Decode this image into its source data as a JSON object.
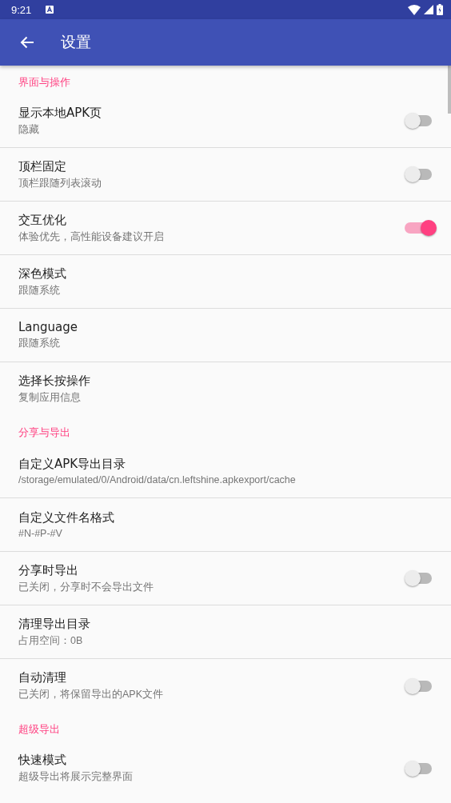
{
  "status_bar": {
    "time": "9:21"
  },
  "app_bar": {
    "title": "设置"
  },
  "sections": [
    {
      "title": "界面与操作",
      "items": [
        {
          "kind": "switch",
          "title": "显示本地APK页",
          "summary": "隐藏",
          "on": false
        },
        {
          "kind": "switch",
          "title": "顶栏固定",
          "summary": "顶栏跟随列表滚动",
          "on": false
        },
        {
          "kind": "switch",
          "title": "交互优化",
          "summary": "体验优先，高性能设备建议开启",
          "on": true
        },
        {
          "kind": "text",
          "title": "深色模式",
          "summary": "跟随系统"
        },
        {
          "kind": "text",
          "title": "Language",
          "summary": "跟随系统"
        },
        {
          "kind": "text",
          "title": "选择长按操作",
          "summary": "复制应用信息"
        }
      ]
    },
    {
      "title": "分享与导出",
      "items": [
        {
          "kind": "text",
          "title": "自定义APK导出目录",
          "summary": "/storage/emulated/0/Android/data/cn.leftshine.apkexport/cache"
        },
        {
          "kind": "text",
          "title": "自定义文件名格式",
          "summary": "#N-#P-#V"
        },
        {
          "kind": "switch",
          "title": "分享时导出",
          "summary": "已关闭，分享时不会导出文件",
          "on": false
        },
        {
          "kind": "text",
          "title": "清理导出目录",
          "summary": "占用空间：0B"
        },
        {
          "kind": "switch",
          "title": "自动清理",
          "summary": "已关闭，将保留导出的APK文件",
          "on": false
        }
      ]
    },
    {
      "title": "超级导出",
      "items": [
        {
          "kind": "switch",
          "title": "快速模式",
          "summary": "超级导出将展示完整界面",
          "on": false
        }
      ]
    }
  ]
}
